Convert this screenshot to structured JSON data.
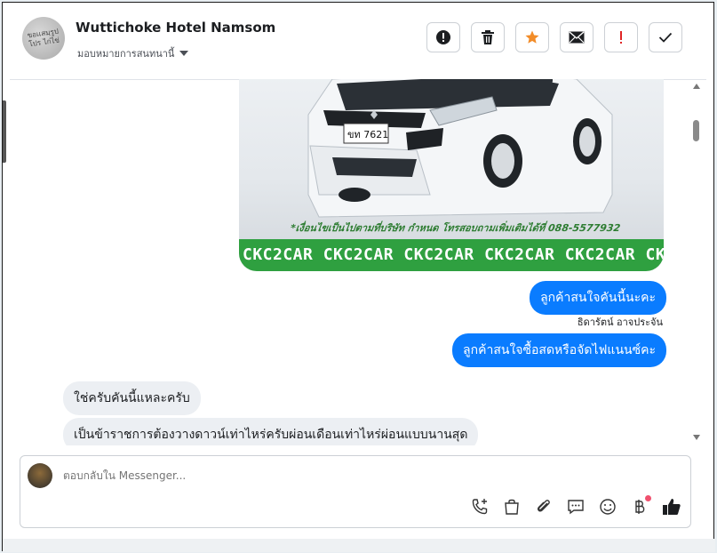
{
  "header": {
    "title": "Wuttichoke Hotel Namsom",
    "assign_label": "มอบหมายการสนทนานี้",
    "avatar_text": "ขอเเสมฺรูปโปร\nไก่ไข่"
  },
  "toolbar": {
    "buttons": [
      {
        "name": "report-icon",
        "color": "#1c1e21"
      },
      {
        "name": "trash-icon",
        "color": "#1c1e21"
      },
      {
        "name": "star-icon",
        "color": "#f28c28"
      },
      {
        "name": "mail-icon",
        "color": "#1c1e21"
      },
      {
        "name": "important-icon",
        "color": "#e02424"
      },
      {
        "name": "check-icon",
        "color": "#1c1e21"
      }
    ]
  },
  "car_image": {
    "plate": "ขท 7621",
    "caption": "*เงื่อนไขเป็นไปตามที่บริษัท กำหนด โทรสอบถามเพิ่มเติมได้ที่ 088-5577932",
    "banner": "CKC2CAR CKC2CAR CKC2CAR CKC2CAR CKC2CAR CKC2"
  },
  "messages": [
    {
      "from": "outgoing",
      "text": "ลูกค้าสนใจคันนี้นะคะ"
    },
    {
      "from": "outgoing",
      "text": "ลูกค้าสนใจซื้อสดหรือจัดไฟแนนซ์คะ"
    },
    {
      "from": "incoming",
      "text": "ใช่ครับคันนี้แหละครับ"
    },
    {
      "from": "incoming",
      "text": "เป็นข้าราชการต้องวางดาวน์เท่าไหร่ครับผ่อนเดือนเท่าไหร่ผ่อนแบบนานสุด"
    }
  ],
  "sender_label": "ธิดารัตน์ อาจประจัน",
  "composer": {
    "placeholder": "ตอบกลับใน Messenger...",
    "icons": [
      "phone-plus-icon",
      "bag-icon",
      "paperclip-icon",
      "chat-icon",
      "emoji-icon",
      "baht-icon",
      "like-icon"
    ]
  },
  "colors": {
    "accent": "#0a7cff",
    "incoming_bubble": "#eceff3",
    "banner_green": "#2fa040"
  }
}
